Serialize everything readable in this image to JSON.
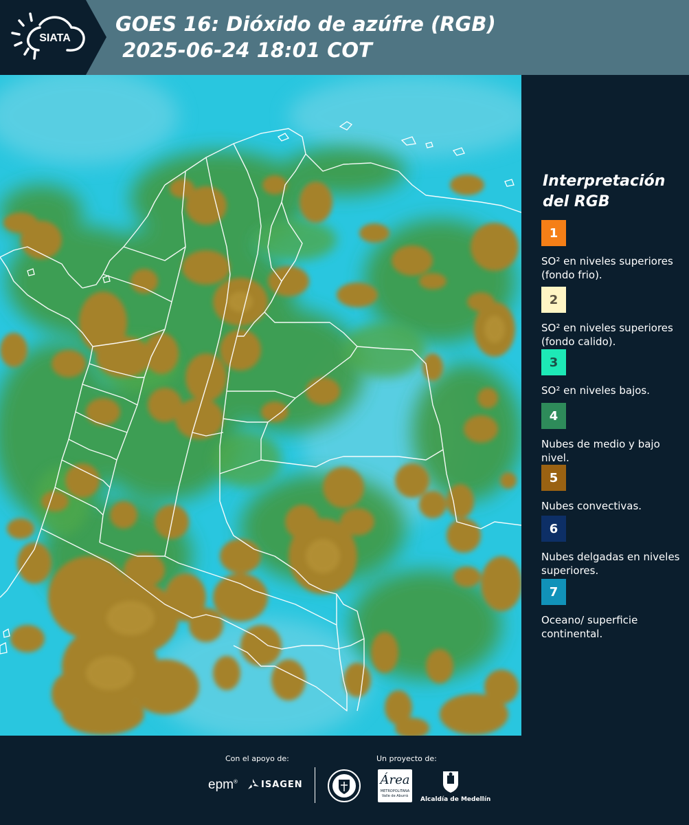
{
  "header": {
    "logo_text": "SIATA",
    "title_line1": "GOES 16: Dióxido de azúfre (RGB)",
    "title_line2": " 2025-06-24 18:01 COT"
  },
  "legend": {
    "title": "Interpretación del RGB",
    "items": [
      {
        "number": "1",
        "text": "SO² en niveles superiores (fondo frio).",
        "color": "#f57f17"
      },
      {
        "number": "2",
        "text": "SO² en niveles superiores (fondo calido).",
        "color": "#fff5c4"
      },
      {
        "number": "3",
        "text": "SO² en niveles bajos.",
        "color": "#1de9b6"
      },
      {
        "number": "4",
        "text": "Nubes de medio y bajo nivel.",
        "color": "#2e8b5a"
      },
      {
        "number": "5",
        "text": "Nubes convectivas.",
        "color": "#9a6212"
      },
      {
        "number": "6",
        "text": "Nubes delgadas en niveles superiores.",
        "color": "#0d2f66"
      },
      {
        "number": "7",
        "text": "Oceano/ superficie continental.",
        "color": "#1192b9"
      }
    ]
  },
  "footer": {
    "support_label": "Con el apoyo de:",
    "project_label": "Un proyecto de:",
    "epm": "epm",
    "isagen": "ISAGEN",
    "area_main": "Área",
    "area_sub1": "METROPOLITANA",
    "area_sub2": "Valle de Aburrá",
    "alcaldia": "Alcaldía de Medellín"
  },
  "colors": {
    "header_bg": "#4f7583",
    "logo_bg": "#0b1e2d",
    "panel_bg": "#0b1e2d",
    "ocean_cyan": "#27c7e0",
    "convective_brown": "#a5822a",
    "vegetation_green": "#3f9a45"
  }
}
